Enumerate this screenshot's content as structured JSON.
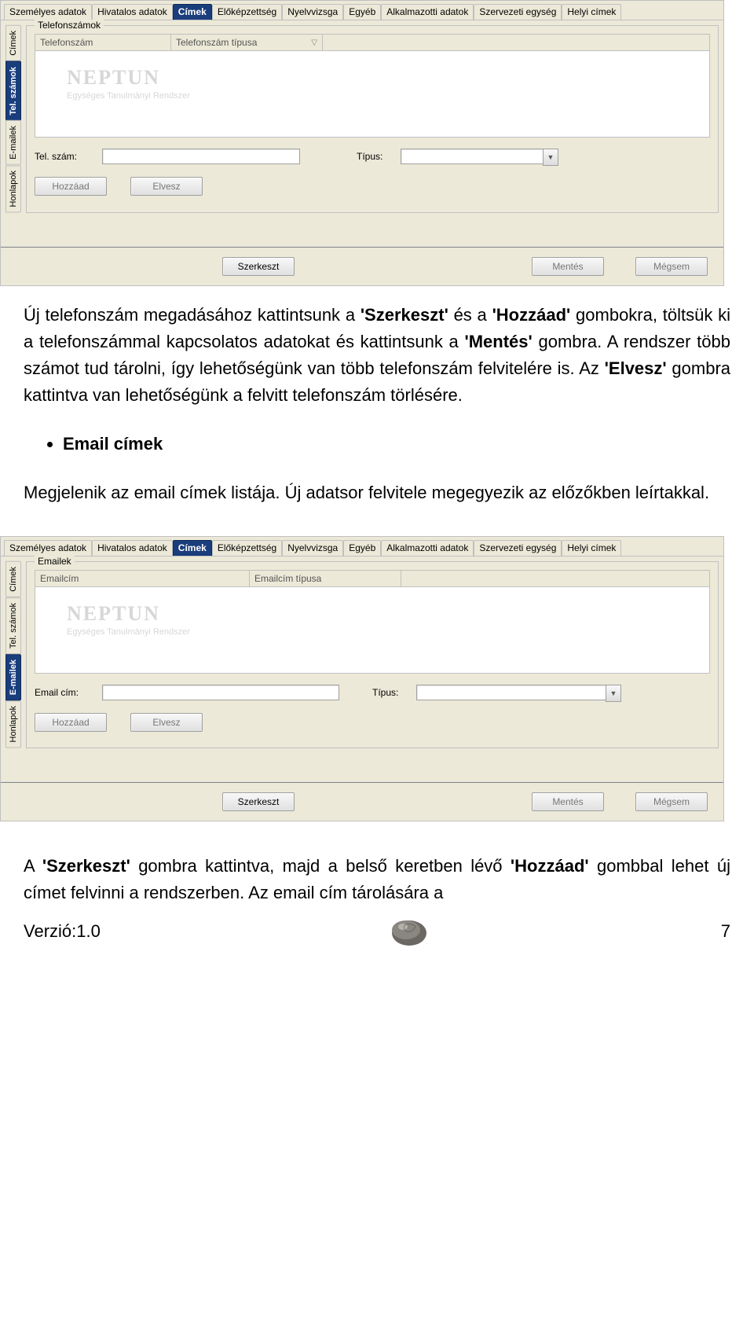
{
  "tabs": {
    "t0": "Személyes adatok",
    "t1": "Hivatalos adatok",
    "t2": "Címek",
    "t3": "Előképzettség",
    "t4": "Nyelvvizsga",
    "t5": "Egyéb",
    "t6": "Alkalmazotti adatok",
    "t7": "Szervezeti egység",
    "t8": "Helyi címek"
  },
  "sideTabs": {
    "s0": "Címek",
    "s1": "Tel. számok",
    "s2": "E-mailek",
    "s3": "Honlapok"
  },
  "panel1": {
    "groupLabel": "Telefonszámok",
    "col1": "Telefonszám",
    "col2": "Telefonszám típusa",
    "wmTitle": "NEPTUN",
    "wmSub": "Egységes Tanulmányi Rendszer",
    "fieldLabel": "Tel. szám:",
    "typeLabel": "Típus:",
    "addBtn": "Hozzáad",
    "removeBtn": "Elvesz"
  },
  "panel2": {
    "groupLabel": "Emailek",
    "col1": "Emailcím",
    "col2": "Emailcím típusa",
    "wmTitle": "NEPTUN",
    "wmSub": "Egységes Tanulmányi Rendszer",
    "fieldLabel": "Email cím:",
    "typeLabel": "Típus:",
    "addBtn": "Hozzáad",
    "removeBtn": "Elvesz"
  },
  "bottomButtons": {
    "edit": "Szerkeszt",
    "save": "Mentés",
    "cancel": "Mégsem"
  },
  "doc": {
    "p1a": "Új telefonszám megadásához kattintsunk a ",
    "p1b": "'Szerkeszt'",
    "p1c": " és a ",
    "p1d": "'Hozzáad'",
    "p1e": " gombokra, töltsük ki a telefonszámmal kapcsolatos adatokat és kattintsunk a ",
    "p1f": "'Mentés'",
    "p1g": " gombra. A rendszer több számot tud tárolni, így lehetőségünk van több telefonszám felvitelére is. Az ",
    "p1h": "'Elvesz'",
    "p1i": " gombra kattintva van lehetőségünk a felvitt telefonszám törlésére.",
    "bullet1": "Email címek",
    "p2": "Megjelenik az email címek listája. Új adatsor felvitele megegyezik az előzőkben leírtakkal.",
    "p3a": "A ",
    "p3b": "'Szerkeszt'",
    "p3c": " gombra kattintva, majd a belső keretben lévő ",
    "p3d": "'Hozzáad'",
    "p3e": " gombbal lehet új címet felvinni a rendszerben. Az email cím tárolására a",
    "version": "Verzió:1.0",
    "pageNum": "7"
  }
}
